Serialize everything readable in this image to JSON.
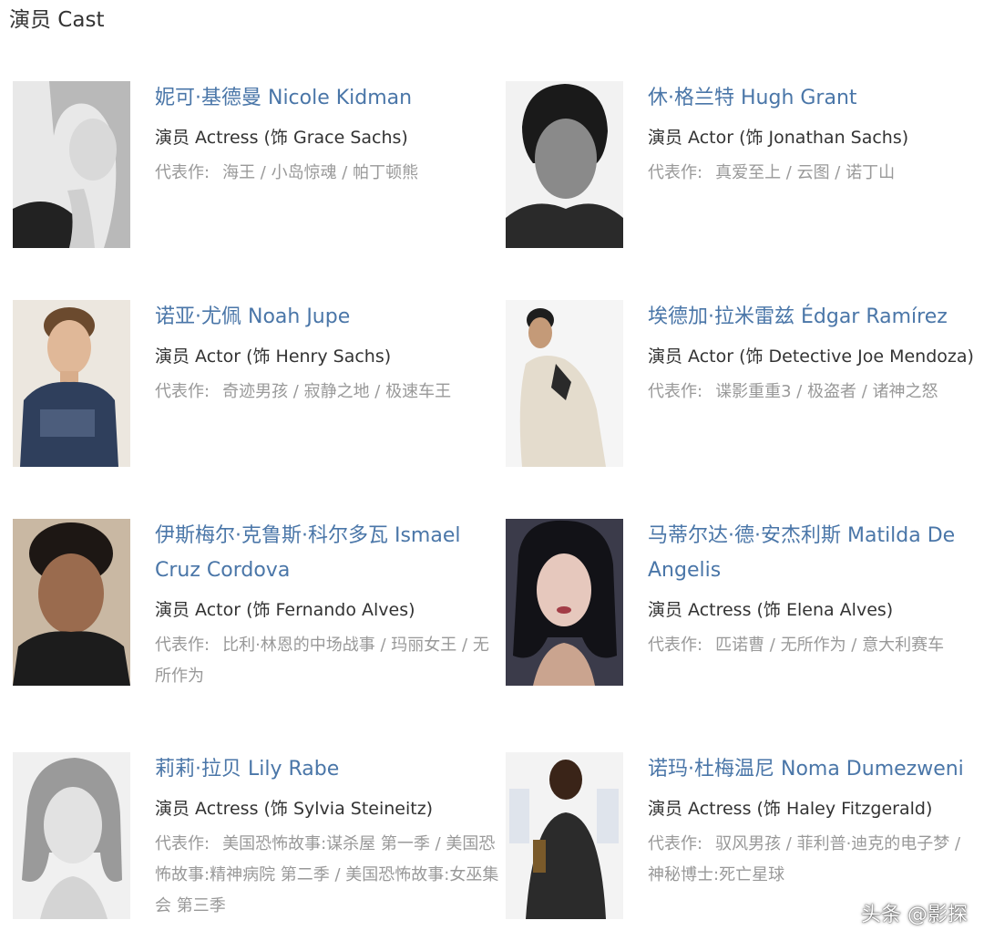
{
  "section": {
    "title": "演员 Cast"
  },
  "cast": [
    {
      "name": "妮可·基德曼 Nicole Kidman",
      "role": "演员 Actress (饰 Grace Sachs)",
      "works_label": "代表作:",
      "works": "海王 / 小岛惊魂 / 帕丁顿熊"
    },
    {
      "name": "休·格兰特 Hugh Grant",
      "role": "演员 Actor (饰 Jonathan Sachs)",
      "works_label": "代表作:",
      "works": "真爱至上 / 云图 / 诺丁山"
    },
    {
      "name": "诺亚·尤佩 Noah Jupe",
      "role": "演员 Actor (饰 Henry Sachs)",
      "works_label": "代表作:",
      "works": "奇迹男孩 / 寂静之地 / 极速车王"
    },
    {
      "name": "埃德加·拉米雷兹 Édgar Ramírez",
      "role": "演员 Actor (饰 Detective Joe Mendoza)",
      "works_label": "代表作:",
      "works": "谍影重重3 / 极盗者 / 诸神之怒"
    },
    {
      "name": "伊斯梅尔·克鲁斯·科尔多瓦 Ismael Cruz Cordova",
      "role": "演员 Actor (饰 Fernando Alves)",
      "works_label": "代表作:",
      "works": "比利·林恩的中场战事 / 玛丽女王 / 无所作为"
    },
    {
      "name": "马蒂尔达·德·安杰利斯 Matilda De Angelis",
      "role": "演员 Actress (饰 Elena Alves)",
      "works_label": "代表作:",
      "works": "匹诺曹 / 无所作为 / 意大利赛车"
    },
    {
      "name": "莉莉·拉贝 Lily Rabe",
      "role": "演员 Actress (饰 Sylvia Steineitz)",
      "works_label": "代表作:",
      "works": "美国恐怖故事:谋杀屋 第一季 / 美国恐怖故事:精神病院 第二季 / 美国恐怖故事:女巫集会 第三季"
    },
    {
      "name": "诺玛·杜梅温尼 Noma Dumezweni",
      "role": "演员 Actress (饰 Haley Fitzgerald)",
      "works_label": "代表作:",
      "works": "驭风男孩 / 菲利普·迪克的电子梦 / 神秘博士:死亡星球"
    }
  ],
  "watermark": {
    "text": "头条 @影探"
  }
}
